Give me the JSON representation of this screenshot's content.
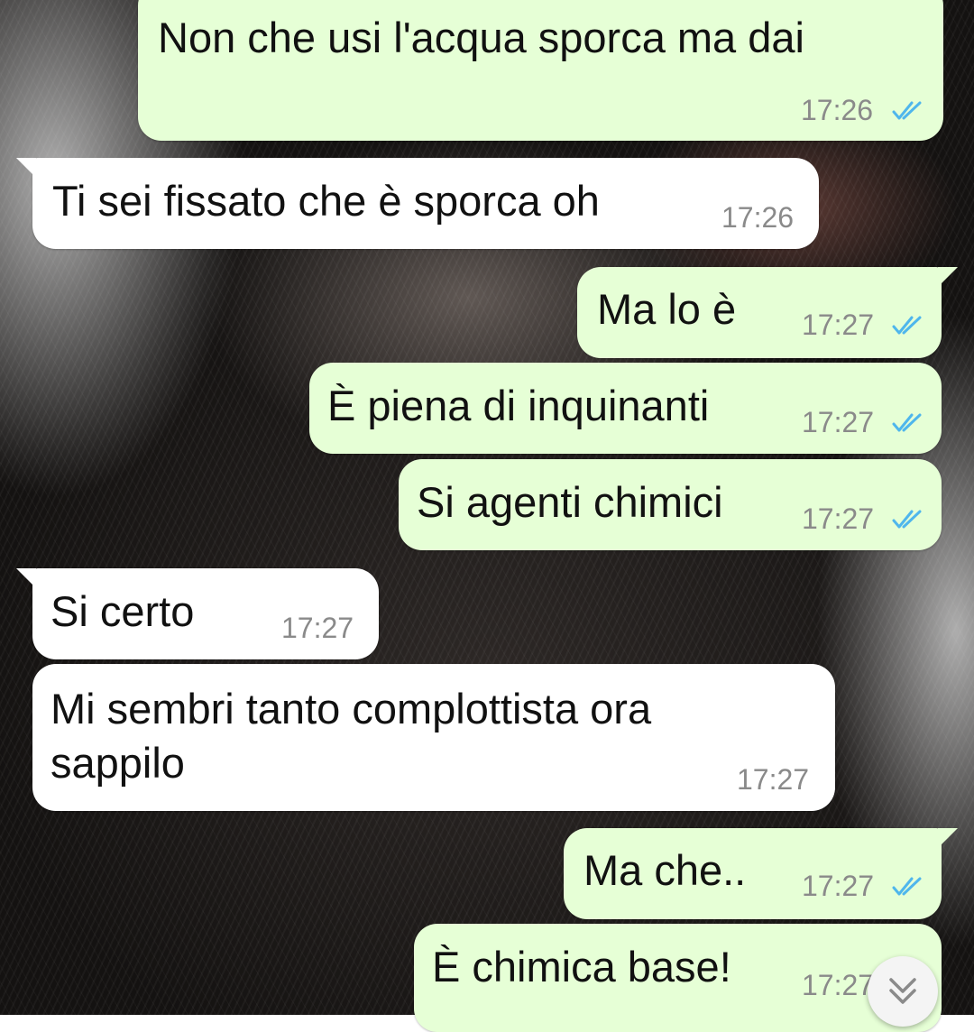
{
  "chat": {
    "messages": [
      {
        "direction": "out",
        "text": "Non che usi l'acqua sporca ma dai",
        "time": "17:26",
        "status": "read"
      },
      {
        "direction": "in",
        "text": "Ti sei fissato che è sporca oh",
        "time": "17:26"
      },
      {
        "direction": "out",
        "text": "Ma lo è",
        "time": "17:27",
        "status": "read"
      },
      {
        "direction": "out",
        "text": "È piena di inquinanti",
        "time": "17:27",
        "status": "read"
      },
      {
        "direction": "out",
        "text": "Si agenti chimici",
        "time": "17:27",
        "status": "read"
      },
      {
        "direction": "in",
        "text": "Si certo",
        "time": "17:27"
      },
      {
        "direction": "in",
        "text_line1": "Mi sembri tanto complottista ora",
        "text_line2": "sappilo",
        "time": "17:27"
      },
      {
        "direction": "out",
        "text": "Ma che..",
        "time": "17:27",
        "status": "read"
      },
      {
        "direction": "out",
        "text": "È chimica base!",
        "time": "17:27",
        "status": "read"
      }
    ]
  },
  "colors": {
    "outgoing_bubble": "#e6ffd6",
    "incoming_bubble": "#ffffff",
    "timestamp": "#8a8a8a",
    "read_ticks": "#4fb6ec"
  },
  "icons": {
    "read_receipt": "double-check-icon",
    "scroll_down": "chevron-down-double-icon"
  }
}
